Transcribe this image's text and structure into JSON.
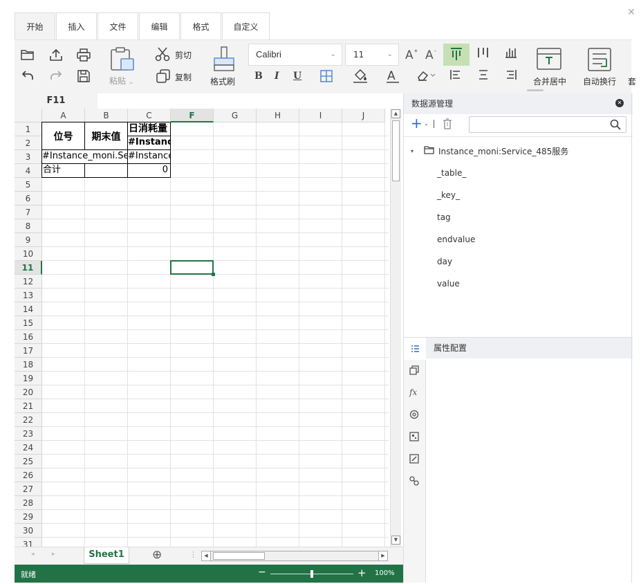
{
  "window": {
    "close_glyph": "✕"
  },
  "tabs": [
    "开始",
    "插入",
    "文件",
    "编辑",
    "格式",
    "自定义"
  ],
  "ribbon": {
    "paste_label": "粘贴",
    "cut_label": "剪切",
    "copy_label": "复制",
    "format_painter_label": "格式刷",
    "font_name": "Calibri",
    "font_size": "11",
    "bold": "B",
    "italic": "I",
    "underline": "U",
    "merge_center_label": "合并居中",
    "wrap_text_label": "自动换行",
    "overflow_label": "套"
  },
  "namebox": "F11",
  "sheet": {
    "columns": [
      "A",
      "B",
      "C",
      "F",
      "G",
      "H",
      "I",
      "J"
    ],
    "col_labels": [
      "A",
      "B",
      "C",
      "F",
      "G",
      "H",
      "I",
      "J"
    ],
    "selected_col": "F",
    "selected_row": "11",
    "rows": [
      "1",
      "2",
      "3",
      "4",
      "5",
      "6",
      "7",
      "8",
      "9",
      "10",
      "11",
      "12",
      "13",
      "14",
      "15",
      "16",
      "17",
      "18",
      "19",
      "20",
      "21",
      "22",
      "23",
      "24",
      "25",
      "26",
      "27",
      "28",
      "29",
      "30",
      "31"
    ],
    "cells": {
      "A1": "位号",
      "B1": "期末值",
      "C1": "日消耗量",
      "C2": "#Instance_",
      "A3": "#Instance_moni.Serv",
      "C3": "#Instance_",
      "A4": "合计",
      "C4": "0"
    }
  },
  "sheet_tabs": {
    "active": "Sheet1",
    "add_glyph": "⊕"
  },
  "status": {
    "ready": "就绪",
    "zoom": "100%",
    "zoom_fraction": 0.5
  },
  "datasource": {
    "title": "数据源管理",
    "root": "Instance_moni:Service_485服务",
    "fields": [
      "_table_",
      "_key_",
      "tag",
      "endvalue",
      "day",
      "value"
    ]
  },
  "properties": {
    "title": "属性配置"
  },
  "colors": {
    "accent": "#217346",
    "header_bg": "#f3f3f3",
    "panel_title_bg": "#eef0f3",
    "align_active_bg": "#c6e0b4"
  }
}
